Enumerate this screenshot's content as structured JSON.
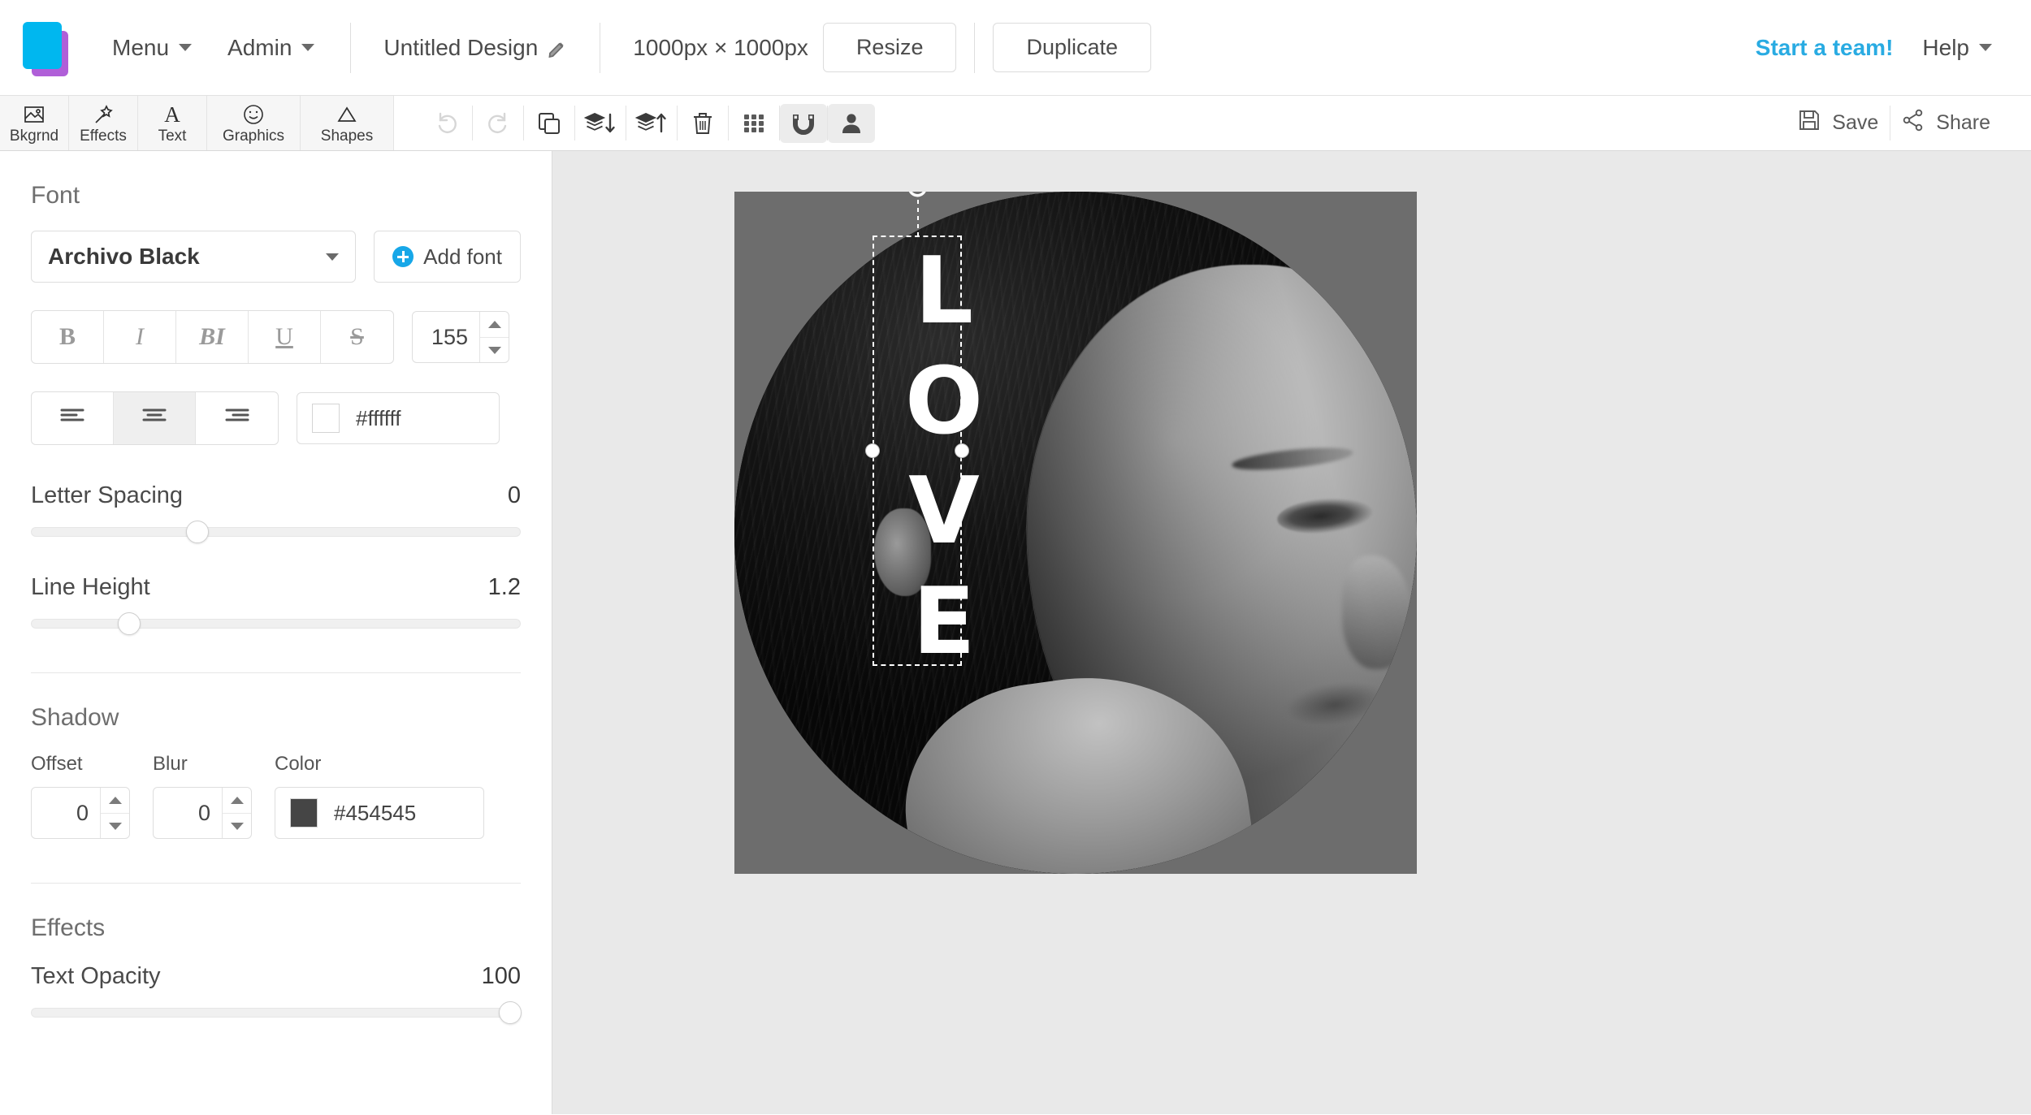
{
  "topbar": {
    "logo_icon": "stacked-squares-logo",
    "logo_colors": {
      "front": "#00b7ef",
      "back": "#b05fd8"
    },
    "menu_label": "Menu",
    "admin_label": "Admin",
    "design_title": "Untitled Design",
    "edit_icon": "pencil-icon",
    "dimensions": "1000px × 1000px",
    "resize_label": "Resize",
    "duplicate_label": "Duplicate",
    "start_team_label": "Start a team!",
    "start_team_color": "#29abe2",
    "help_label": "Help"
  },
  "toolbar": {
    "tabs": [
      {
        "label": "Bkgrnd",
        "icon": "image-icon",
        "active": true
      },
      {
        "label": "Effects",
        "icon": "wand-icon",
        "active": false
      },
      {
        "label": "Text",
        "icon": "text-a-icon",
        "active": false
      },
      {
        "label": "Graphics",
        "icon": "smiley-icon",
        "active": false
      },
      {
        "label": "Shapes",
        "icon": "triangle-icon",
        "active": false
      }
    ],
    "actions": [
      {
        "name": "undo",
        "icon": "undo-icon",
        "disabled": true
      },
      {
        "name": "redo",
        "icon": "redo-icon",
        "disabled": true
      },
      {
        "name": "duplicate",
        "icon": "copy-icon",
        "disabled": false
      },
      {
        "name": "send-back",
        "icon": "layers-down-icon",
        "disabled": false
      },
      {
        "name": "bring-front",
        "icon": "layers-up-icon",
        "disabled": false
      },
      {
        "name": "delete",
        "icon": "trash-icon",
        "disabled": false
      },
      {
        "name": "grid",
        "icon": "grid-icon",
        "disabled": false
      },
      {
        "name": "snap",
        "icon": "magnet-icon",
        "active": true
      },
      {
        "name": "account",
        "icon": "person-icon",
        "active": true
      }
    ],
    "save_label": "Save",
    "save_icon": "floppy-disk-icon",
    "share_label": "Share",
    "share_icon": "share-nodes-icon"
  },
  "panel": {
    "font_section_title": "Font",
    "font_family": "Archivo Black",
    "dropdown_icon": "chevron-down-icon",
    "add_font_label": "Add font",
    "add_font_icon": "plus-circle-icon",
    "style_buttons": [
      {
        "label": "B",
        "name": "bold",
        "active": false
      },
      {
        "label": "I",
        "name": "italic",
        "active": false
      },
      {
        "label": "BI",
        "name": "bold-italic",
        "active": false
      },
      {
        "label": "U",
        "name": "underline",
        "active": false
      },
      {
        "label": "S",
        "name": "strikethrough",
        "active": false
      }
    ],
    "font_size": "155",
    "align_buttons": [
      {
        "name": "align-left",
        "icon": "align-left-icon",
        "active": false
      },
      {
        "name": "align-center",
        "icon": "align-center-icon",
        "active": true
      },
      {
        "name": "align-right",
        "icon": "align-right-icon",
        "active": false
      }
    ],
    "text_color_hex": "#ffffff",
    "letter_spacing_label": "Letter Spacing",
    "letter_spacing_value": "0",
    "letter_spacing_pct": 34,
    "line_height_label": "Line Height",
    "line_height_value": "1.2",
    "line_height_pct": 20,
    "shadow_section_title": "Shadow",
    "shadow_offset_label": "Offset",
    "shadow_offset_value": "0",
    "shadow_blur_label": "Blur",
    "shadow_blur_value": "0",
    "shadow_color_label": "Color",
    "shadow_color_hex": "#454545",
    "effects_section_title": "Effects",
    "text_opacity_label": "Text Opacity",
    "text_opacity_value": "100",
    "text_opacity_pct": 98
  },
  "canvas": {
    "background": "#e9e9e9",
    "artboard_background": "#6d6d6d",
    "text_layer": "L\nO\nV\nE",
    "text_layer_color": "#ffffff",
    "rotate_handle_icon": "rotate-icon",
    "selection_handles": [
      "left-middle",
      "right-middle"
    ]
  }
}
